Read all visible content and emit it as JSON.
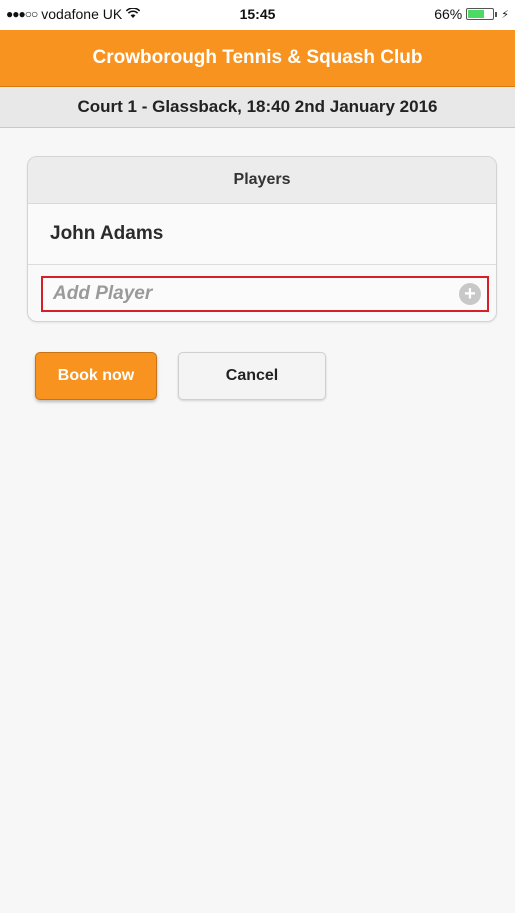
{
  "status_bar": {
    "signal_dots": "●●●○○",
    "carrier": "vodafone UK",
    "wifi_icon": "wifi-icon",
    "time": "15:45",
    "battery_percent": "66%",
    "battery_level": 0.66,
    "charging_icon": "⚡"
  },
  "header": {
    "title": "Crowborough Tennis & Squash Club",
    "color": "#f7931e"
  },
  "subheader": {
    "booking_info": "Court 1 - Glassback, 18:40 2nd January 2016"
  },
  "players_card": {
    "title": "Players",
    "players": [
      "John Adams"
    ],
    "add_player_placeholder": "Add Player",
    "add_icon": "plus-circle-icon"
  },
  "actions": {
    "book_label": "Book now",
    "cancel_label": "Cancel"
  }
}
